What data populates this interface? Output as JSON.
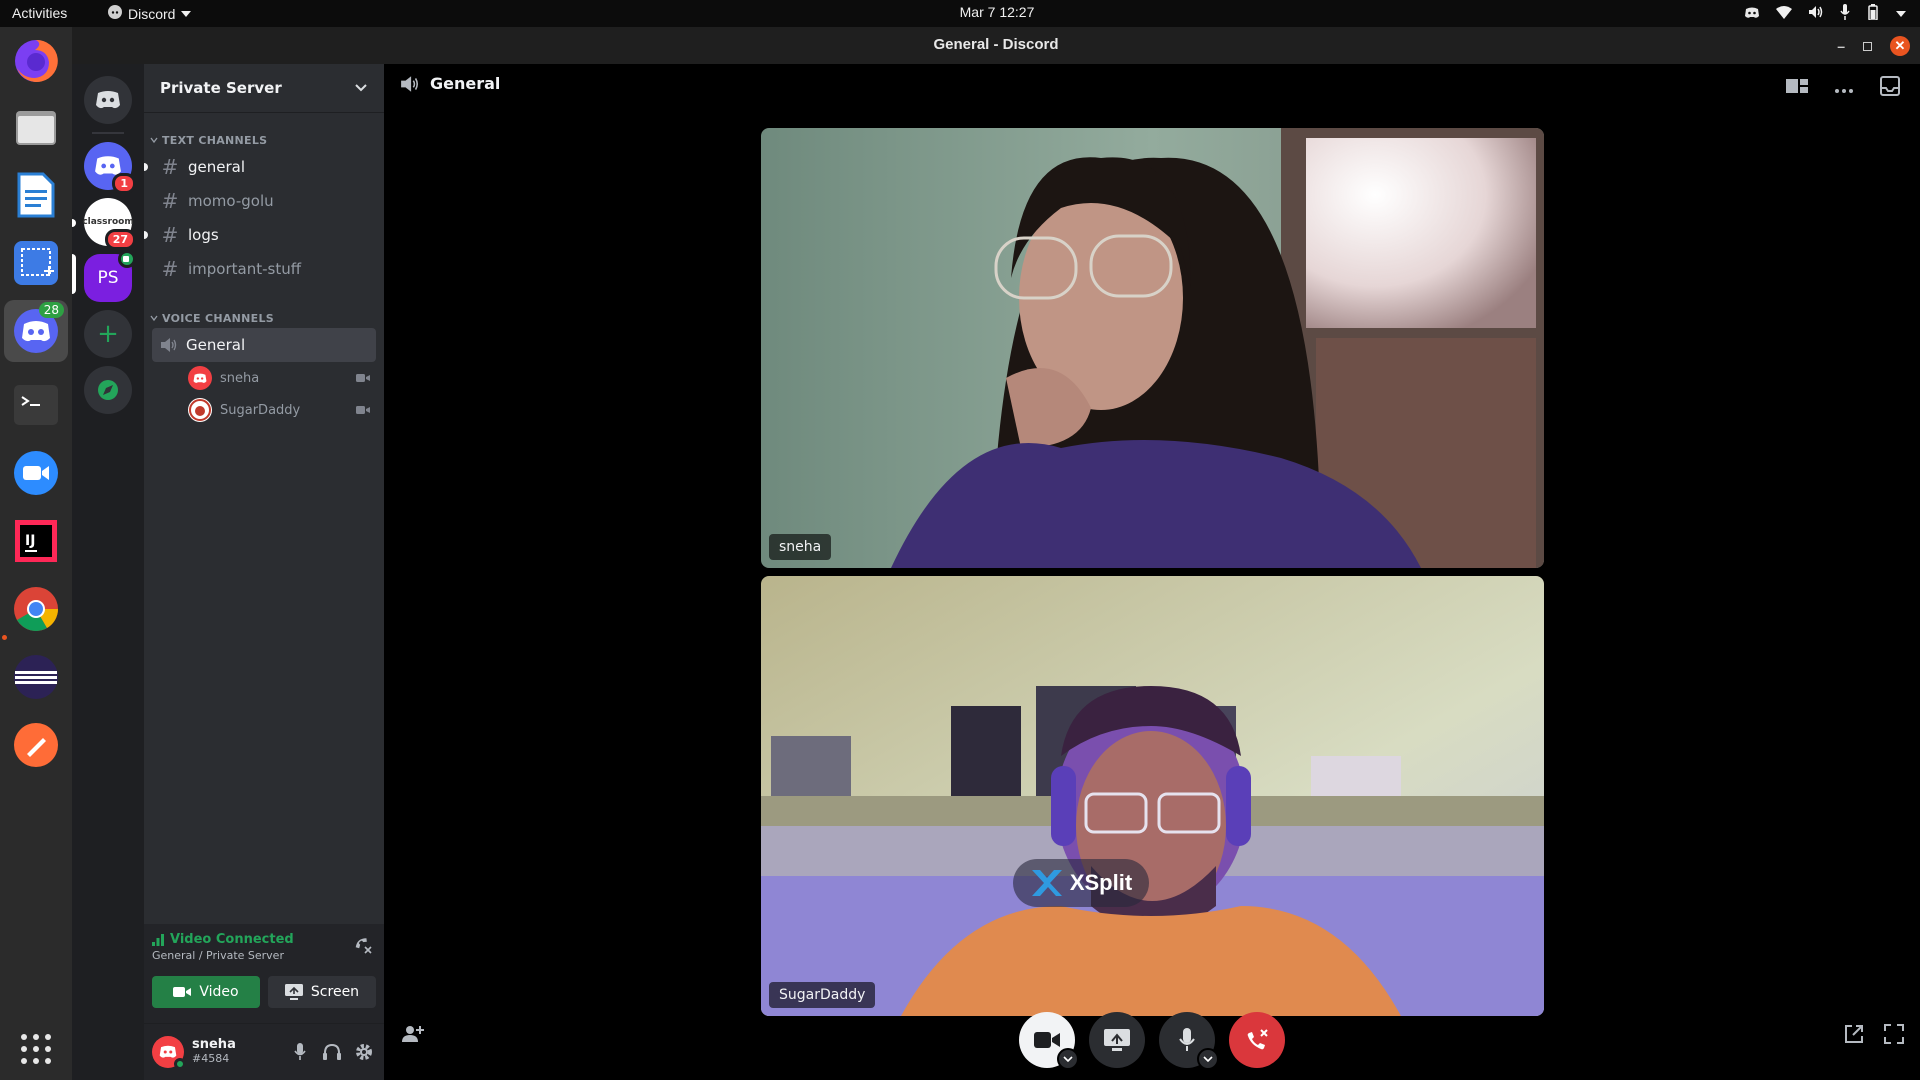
{
  "topbar": {
    "activities": "Activities",
    "app_name": "Discord",
    "datetime": "Mar 7  12:27",
    "tray_icons": [
      "discord-tray-icon",
      "wifi-icon",
      "volume-icon",
      "microphone-icon",
      "battery-icon",
      "system-menu-icon"
    ]
  },
  "dock": {
    "apps": [
      "firefox",
      "files",
      "libreoffice-writer",
      "screenshot-tool",
      "discord",
      "terminal",
      "zoom",
      "intellij-idea",
      "google-chrome",
      "eclipse",
      "postman",
      "show-applications"
    ],
    "discord_badge": "28"
  },
  "window": {
    "title": "General - Discord"
  },
  "rail": {
    "servers": [
      {
        "name": "Direct Messages",
        "icon": "discord-icon",
        "badge": ""
      },
      {
        "name": "server-discord-logo",
        "icon": "discord-icon",
        "badge": "1"
      },
      {
        "name": "server-classroom",
        "icon_text": "classroom",
        "badge": "27"
      },
      {
        "name": "Private Server",
        "icon_text": "PS",
        "badge": ""
      }
    ],
    "add_server": "+",
    "explore": "explore-icon"
  },
  "server": {
    "name": "Private Server"
  },
  "categories": {
    "text": "TEXT CHANNELS",
    "voice": "VOICE CHANNELS"
  },
  "text_channels": [
    {
      "name": "general",
      "unread": true
    },
    {
      "name": "momo-golu",
      "unread": false
    },
    {
      "name": "logs",
      "unread": true
    },
    {
      "name": "important-stuff",
      "unread": false
    }
  ],
  "voice_channel": {
    "name": "General",
    "users": [
      {
        "name": "sneha",
        "video": true
      },
      {
        "name": "SugarDaddy",
        "video": true
      }
    ]
  },
  "connection": {
    "status": "Video Connected",
    "location": "General / Private Server",
    "video_label": "Video",
    "screen_label": "Screen"
  },
  "user": {
    "name": "sneha",
    "tag": "#4584"
  },
  "call": {
    "channel_name": "General",
    "participants": [
      {
        "name": "sneha"
      },
      {
        "name": "SugarDaddy",
        "overlay_logo_text": "XSplit"
      }
    ]
  },
  "colors": {
    "blurple": "#5865f2",
    "green": "#23a55a",
    "red": "#da373c",
    "bg_rail": "#1e1f22",
    "bg_sidebar": "#2b2d31"
  }
}
